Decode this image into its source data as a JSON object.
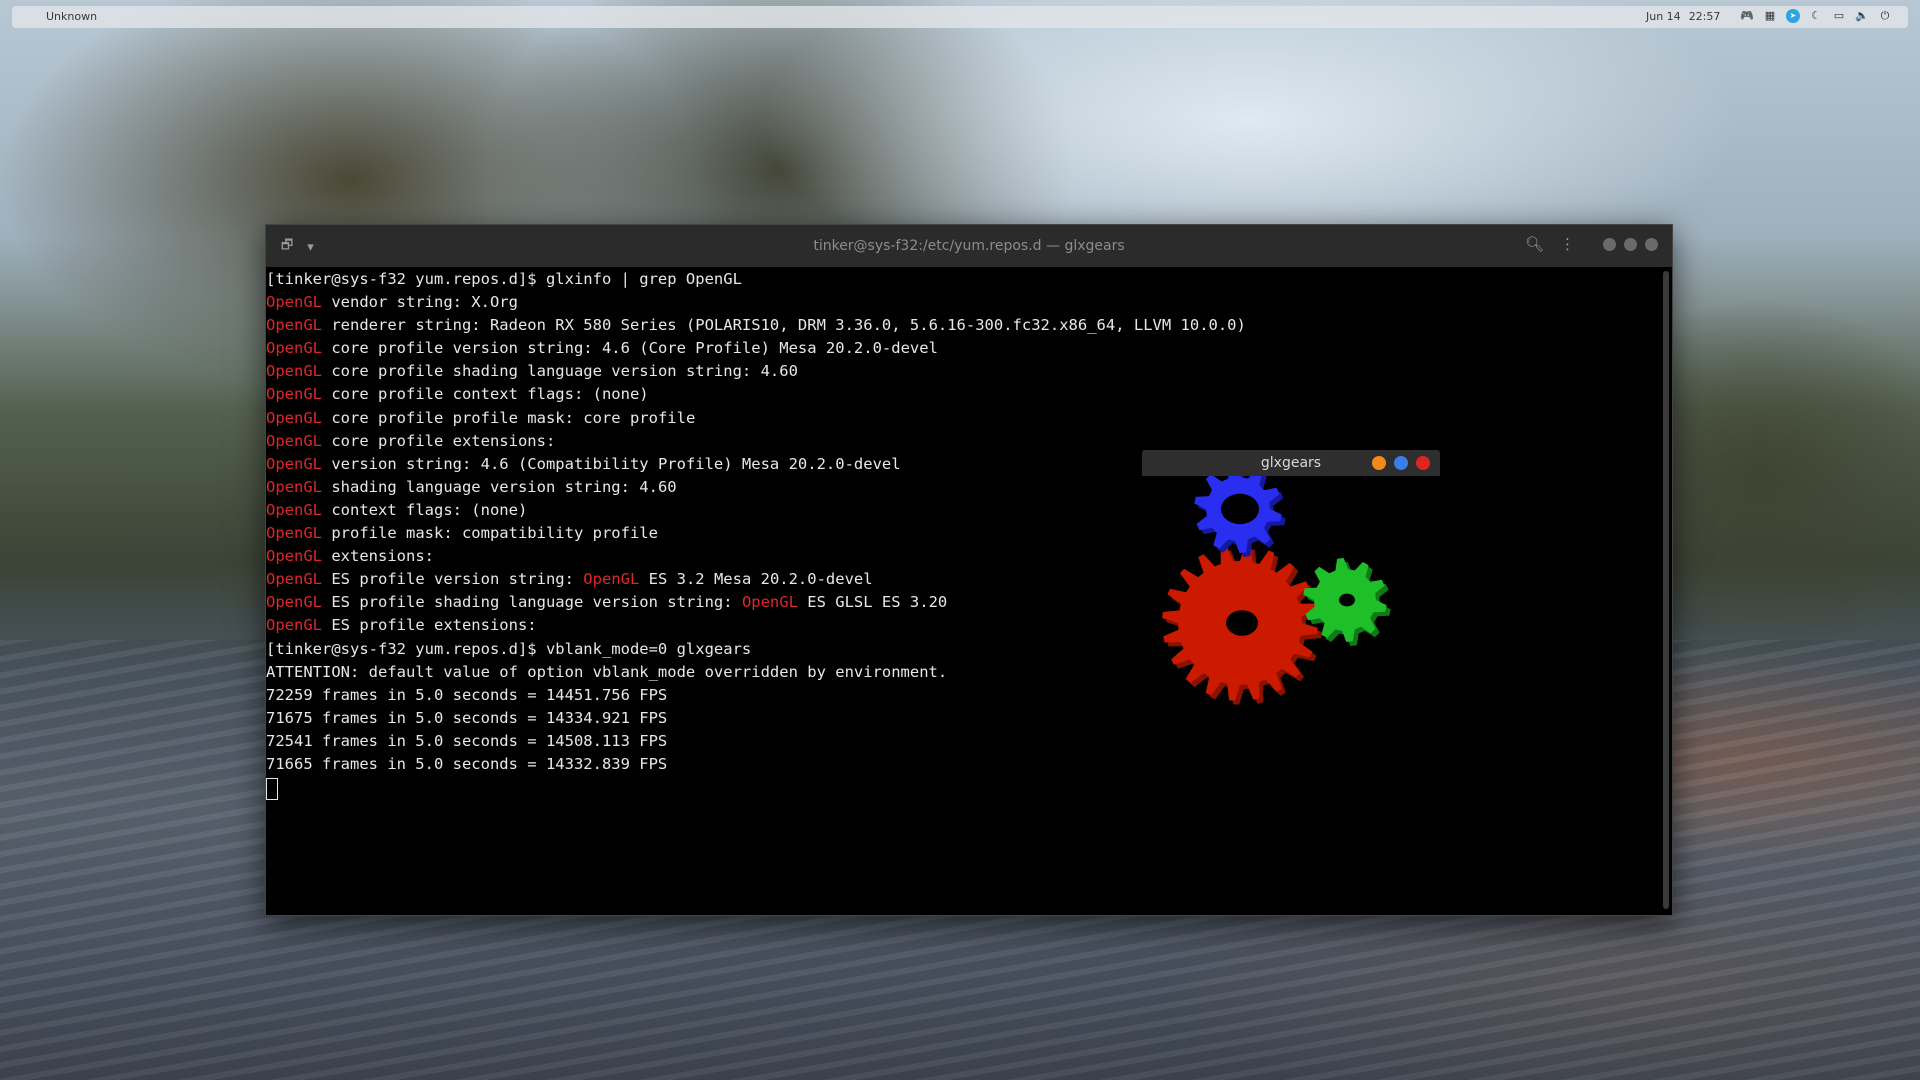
{
  "topbar": {
    "app_name": "Unknown",
    "date": "Jun 14",
    "time": "22:57",
    "tray_icons": [
      "gamepad-icon",
      "grid-icon",
      "telegram-icon",
      "moon-icon",
      "window-icon",
      "volume-icon",
      "power-icon"
    ]
  },
  "terminal": {
    "title": "tinker@sys-f32:/etc/yum.repos.d — glxgears",
    "lines": [
      {
        "pre": "[tinker@sys-f32 yum.repos.d]$ glxinfo | grep OpenGL"
      },
      {
        "red": "OpenGL",
        "rest": " vendor string: X.Org"
      },
      {
        "red": "OpenGL",
        "rest": " renderer string: Radeon RX 580 Series (POLARIS10, DRM 3.36.0, 5.6.16-300.fc32.x86_64, LLVM 10.0.0)"
      },
      {
        "red": "OpenGL",
        "rest": " core profile version string: 4.6 (Core Profile) Mesa 20.2.0-devel"
      },
      {
        "red": "OpenGL",
        "rest": " core profile shading language version string: 4.60"
      },
      {
        "red": "OpenGL",
        "rest": " core profile context flags: (none)"
      },
      {
        "red": "OpenGL",
        "rest": " core profile profile mask: core profile"
      },
      {
        "red": "OpenGL",
        "rest": " core profile extensions:"
      },
      {
        "red": "OpenGL",
        "rest": " version string: 4.6 (Compatibility Profile) Mesa 20.2.0-devel"
      },
      {
        "red": "OpenGL",
        "rest": " shading language version string: 4.60"
      },
      {
        "red": "OpenGL",
        "rest": " context flags: (none)"
      },
      {
        "red": "OpenGL",
        "rest": " profile mask: compatibility profile"
      },
      {
        "red": "OpenGL",
        "rest": " extensions:"
      },
      {
        "red": "OpenGL",
        "rest": " ES profile version string: ",
        "red2": "OpenGL",
        "rest2": " ES 3.2 Mesa 20.2.0-devel"
      },
      {
        "red": "OpenGL",
        "rest": " ES profile shading language version string: ",
        "red2": "OpenGL",
        "rest2": " ES GLSL ES 3.20"
      },
      {
        "red": "OpenGL",
        "rest": " ES profile extensions:"
      },
      {
        "pre": "[tinker@sys-f32 yum.repos.d]$ vblank_mode=0 glxgears"
      },
      {
        "pre": "ATTENTION: default value of option vblank_mode overridden by environment."
      },
      {
        "pre": "72259 frames in 5.0 seconds = 14451.756 FPS"
      },
      {
        "pre": "71675 frames in 5.0 seconds = 14334.921 FPS"
      },
      {
        "pre": "72541 frames in 5.0 seconds = 14508.113 FPS"
      },
      {
        "pre": "71665 frames in 5.0 seconds = 14332.839 FPS"
      }
    ]
  },
  "glxgears": {
    "title": "glxgears",
    "buttons": [
      {
        "name": "minimize-button",
        "color": "#f08a1c"
      },
      {
        "name": "maximize-button",
        "color": "#3b7ee8"
      },
      {
        "name": "close-button",
        "color": "#e02424"
      }
    ],
    "gear_colors": {
      "red": "#cc1a00",
      "green": "#1fbf2a",
      "blue": "#2a2ef0"
    }
  }
}
